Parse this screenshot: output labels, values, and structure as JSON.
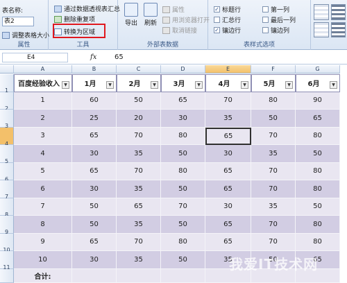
{
  "ribbon": {
    "properties": {
      "table_name_label": "表名称:",
      "table_name_value": "表2",
      "resize_label": "调整表格大小",
      "group_label": "属性"
    },
    "tools": {
      "pivot_label": "通过数据透视表汇总",
      "remove_dup_label": "删除重复项",
      "convert_label": "转换为区域",
      "group_label": "工具"
    },
    "external": {
      "export_label": "导出",
      "refresh_label": "刷新",
      "properties_label": "属性",
      "open_browser_label": "用浏览器打开",
      "unlink_label": "取消链接",
      "group_label": "外部表数据"
    },
    "style_options": {
      "header_row": "标题行",
      "total_row": "汇总行",
      "banded_rows": "镶边行",
      "first_col": "第一列",
      "last_col": "最后一列",
      "banded_cols": "镶边列",
      "header_row_checked": "✓",
      "banded_rows_checked": "✓",
      "group_label": "表样式选项"
    }
  },
  "formula_bar": {
    "name_box": "E4",
    "fx": "fx",
    "value": "65"
  },
  "columns": [
    "A",
    "B",
    "C",
    "D",
    "E",
    "F",
    "G"
  ],
  "rows": [
    "1",
    "2",
    "3",
    "4",
    "5",
    "6",
    "7",
    "8",
    "9",
    "10",
    "11"
  ],
  "table_headers": [
    "百度经验收入",
    "1月",
    "2月",
    "3月",
    "4月",
    "5月",
    "6月"
  ],
  "table_rows": [
    [
      "1",
      "60",
      "50",
      "65",
      "70",
      "80",
      "90"
    ],
    [
      "2",
      "25",
      "20",
      "30",
      "35",
      "50",
      "65"
    ],
    [
      "3",
      "65",
      "70",
      "80",
      "65",
      "70",
      "80"
    ],
    [
      "4",
      "30",
      "35",
      "50",
      "30",
      "35",
      "50"
    ],
    [
      "5",
      "65",
      "70",
      "80",
      "65",
      "70",
      "80"
    ],
    [
      "6",
      "30",
      "35",
      "50",
      "65",
      "70",
      "80"
    ],
    [
      "7",
      "50",
      "65",
      "70",
      "30",
      "35",
      "50"
    ],
    [
      "8",
      "50",
      "35",
      "50",
      "65",
      "70",
      "80"
    ],
    [
      "9",
      "65",
      "70",
      "80",
      "65",
      "70",
      "80"
    ],
    [
      "10",
      "30",
      "35",
      "50",
      "35",
      "50",
      "65"
    ]
  ],
  "total_label": "合计:",
  "watermark": "我爱IT技术网",
  "colors": {
    "band_light": "#e9e6f1",
    "band_dark": "#d2cde3",
    "accent_red": "#e0181e",
    "selected_header": "#f3c06a"
  }
}
